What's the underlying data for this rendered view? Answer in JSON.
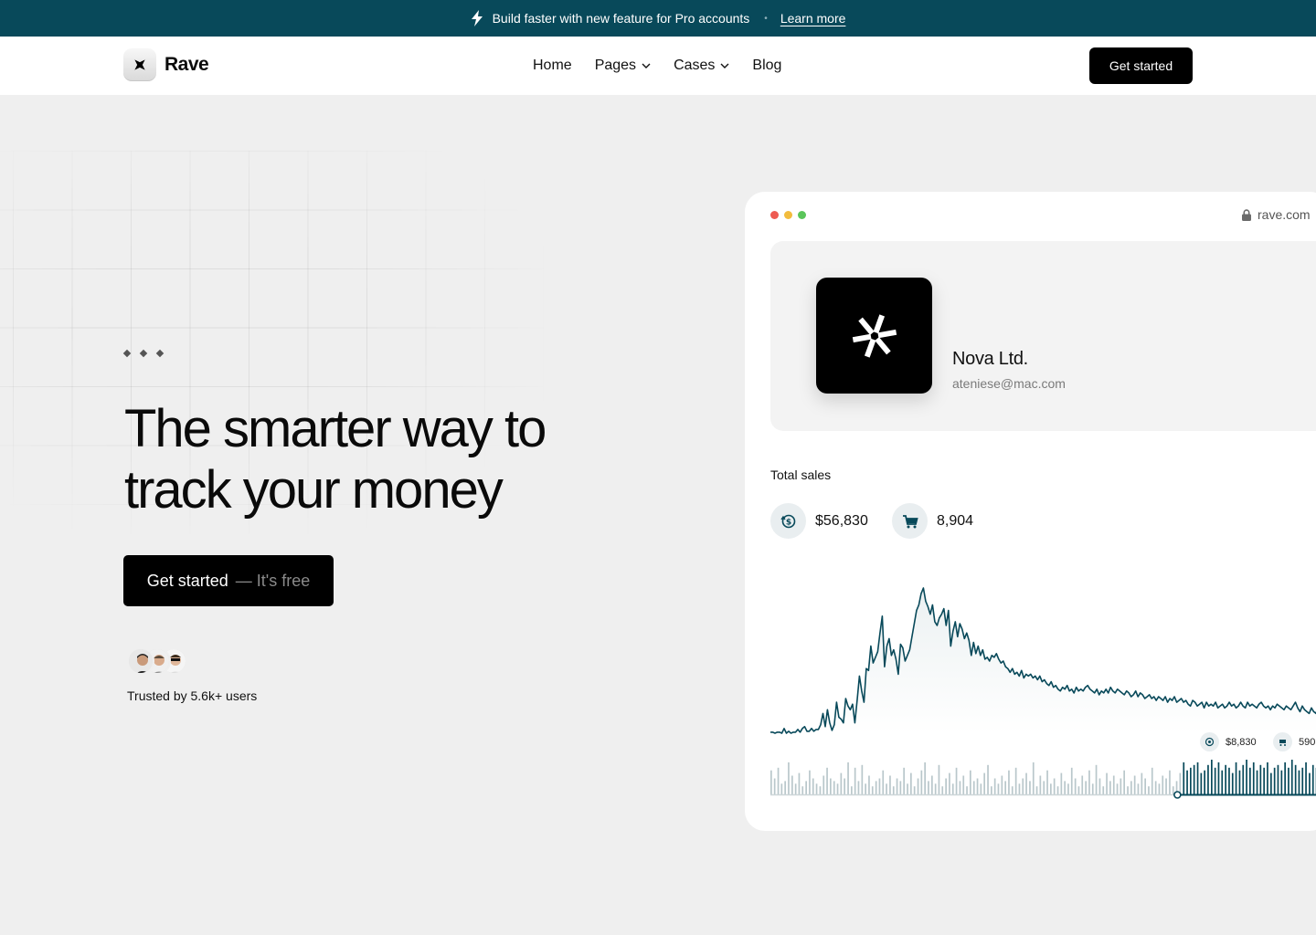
{
  "announcement": {
    "text": "Build faster with new feature for Pro accounts",
    "link": "Learn more",
    "separator": "•"
  },
  "nav": {
    "logo": "Rave",
    "items": [
      {
        "label": "Home",
        "dropdown": false
      },
      {
        "label": "Pages",
        "dropdown": true
      },
      {
        "label": "Cases",
        "dropdown": true
      },
      {
        "label": "Blog",
        "dropdown": false
      }
    ],
    "cta": "Get started"
  },
  "hero": {
    "title_line1": "The smarter way to",
    "title_line2": "track your money",
    "cta_main": "Get started",
    "cta_sub": "— It's free",
    "trusted": "Trusted by 5.6k+ users"
  },
  "dashboard": {
    "url": "rave.com",
    "company_name": "Nova Ltd.",
    "company_email": "ateniese@mac.com",
    "total_sales_label": "Total sales",
    "sales_amount": "$56,830",
    "orders_count": "8,904",
    "mini_amount": "$8,830",
    "mini_orders": "590"
  },
  "colors": {
    "accent": "#08495a",
    "primary": "#000000",
    "background": "#efefef",
    "traffic_red": "#ee5b52",
    "traffic_yellow": "#f2bc3d",
    "traffic_green": "#5ac55a"
  },
  "chart_data": {
    "type": "line",
    "series": [
      {
        "values": [
          2,
          2,
          1,
          2,
          2,
          1,
          6,
          1,
          3,
          1,
          2,
          2,
          5,
          2,
          6,
          8,
          3,
          3,
          6,
          3,
          5,
          5,
          10,
          22,
          8,
          26,
          12,
          4,
          10,
          34,
          18,
          16,
          12,
          38,
          30,
          26,
          32,
          12,
          36,
          62,
          46,
          34,
          70,
          68,
          94,
          76,
          82,
          88,
          108,
          126,
          72,
          94,
          102,
          84,
          90,
          80,
          64,
          96,
          92,
          78,
          84,
          90,
          104,
          118,
          132,
          138,
          150,
          156,
          142,
          136,
          128,
          138,
          120,
          116,
          124,
          128,
          134,
          116,
          132,
          94,
          110,
          120,
          104,
          118,
          112,
          102,
          108,
          100,
          84,
          98,
          86,
          94,
          84,
          90,
          80,
          82,
          78,
          84,
          82,
          86,
          80,
          76,
          78,
          72,
          70,
          66,
          70,
          64,
          66,
          62,
          68,
          60,
          64,
          62,
          64,
          60,
          62,
          58,
          62,
          56,
          58,
          54,
          52,
          56,
          50,
          52,
          48,
          46,
          50,
          48,
          52,
          46,
          48,
          44,
          50,
          46,
          48,
          46,
          50,
          52,
          48,
          46,
          44,
          48,
          42,
          46,
          44,
          48,
          44,
          50,
          46,
          44,
          48,
          46,
          44,
          42,
          46,
          44,
          40,
          42,
          46,
          40,
          44,
          42,
          38,
          40,
          42,
          38,
          40,
          36,
          40,
          38,
          36,
          40,
          34,
          38,
          36,
          40,
          34,
          36,
          38,
          34,
          36,
          32,
          30,
          36,
          34,
          30,
          32,
          34,
          28,
          34,
          30,
          32,
          30,
          34,
          28,
          30,
          32,
          28,
          30,
          34,
          30,
          32,
          28,
          30,
          34,
          30,
          28,
          34,
          30,
          32,
          30,
          28,
          32,
          34,
          30,
          28,
          30,
          26,
          30,
          28,
          32,
          30,
          28,
          26,
          30,
          28,
          26,
          30,
          34,
          28,
          24,
          30,
          26,
          24,
          22,
          28,
          24,
          22,
          30,
          24,
          28,
          32,
          26,
          30
        ]
      }
    ],
    "volume": [
      9,
      6,
      10,
      4,
      5,
      12,
      7,
      4,
      8,
      3,
      5,
      9,
      6,
      4,
      3,
      7,
      10,
      6,
      5,
      4,
      8,
      6,
      12,
      3,
      10,
      5,
      11,
      4,
      7,
      3,
      5,
      6,
      9,
      4,
      7,
      3,
      6,
      5,
      10,
      4,
      8,
      3,
      6,
      9,
      12,
      5,
      7,
      4,
      11,
      3,
      6,
      8,
      4,
      10,
      5,
      7,
      3,
      9,
      5,
      6,
      4,
      8,
      11,
      3,
      6,
      4,
      7,
      5,
      9,
      3,
      10,
      4,
      6,
      8,
      5,
      12,
      3,
      7,
      5,
      9,
      4,
      6,
      3,
      8,
      5,
      4,
      10,
      6,
      3,
      7,
      5,
      9,
      4,
      11,
      6,
      3,
      8,
      5,
      7,
      4,
      6,
      9,
      3,
      5,
      7,
      4,
      8,
      6,
      3,
      10,
      5,
      4,
      7,
      6,
      9,
      3,
      5,
      8,
      12,
      9,
      10,
      11,
      12,
      8,
      9,
      11,
      13,
      10,
      12,
      9,
      11,
      10,
      8,
      12,
      9,
      11,
      13,
      10,
      12,
      9,
      11,
      10,
      12,
      8,
      10,
      11,
      9,
      12,
      10,
      13,
      11,
      9,
      10,
      12,
      8,
      11,
      10,
      9,
      12,
      10
    ],
    "volume_highlight_from": 118
  }
}
